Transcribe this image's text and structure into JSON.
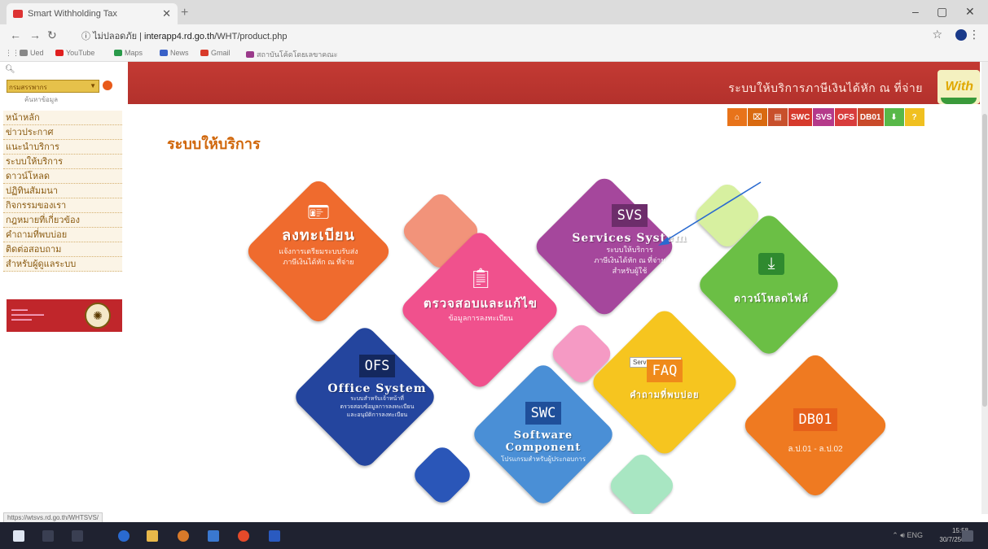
{
  "browser": {
    "tab_title": "Smart Withholding Tax",
    "new_tab": "+",
    "url_security": "ไม่ปลอดภัย",
    "url_host": "interapp4.rd.go.th",
    "url_path": "/WHT/product.php",
    "bookmarks": [
      {
        "label": "Ued",
        "color": "#888888"
      },
      {
        "label": "YouTube",
        "color": "#e02020"
      },
      {
        "label": "Maps",
        "color": "#2a9a4a"
      },
      {
        "label": "News",
        "color": "#3a62c8"
      },
      {
        "label": "Gmail",
        "color": "#d83a2a"
      },
      {
        "label": "สถาบันโค้ดโดยเลขาคณะ",
        "color": "#9a3a8a"
      }
    ]
  },
  "sidebar": {
    "select_value": "กรมสรรพากร",
    "search_sub": "ค้นหาข้อมูล",
    "menu": [
      "หน้าหลัก",
      "ข่าวประกาศ",
      "แนะนำบริการ",
      "ระบบให้บริการ",
      "ดาวน์โหลด",
      "ปฏิทินสัมมนา",
      "กิจกรรมของเรา",
      "กฎหมายที่เกี่ยวข้อง",
      "คำถามที่พบบ่อย",
      "ติดต่อสอบถาม",
      "สำหรับผู้ดูแลระบบ"
    ]
  },
  "header": {
    "title": "ระบบให้บริการภาษีเงินได้หัก ณ ที่จ่าย",
    "logo_text": "With"
  },
  "icon_row": [
    {
      "label": "⌂",
      "color": "#e8731a"
    },
    {
      "label": "⌧",
      "color": "#d96a10"
    },
    {
      "label": "▤",
      "color": "#c8502c"
    },
    {
      "label": "SWC",
      "color": "#d63a2c"
    },
    {
      "label": "SVS",
      "color": "#b53a8a"
    },
    {
      "label": "OFS",
      "color": "#d83c3c"
    },
    {
      "label": "DB01",
      "color": "#c94a2a"
    },
    {
      "label": "⬇",
      "color": "#58b848"
    },
    {
      "label": "?",
      "color": "#f0c020"
    }
  ],
  "section_title": "ระบบให้บริการ",
  "tiles": {
    "register": {
      "title": "ลงทะเบียน",
      "sub1": "แจ้งการเตรียมระบบรับส่ง",
      "sub2": "ภาษีเงินได้หัก ณ ที่จ่าย",
      "color": "#ef6b2e"
    },
    "verify": {
      "title": "ตรวจสอบและแก้ไข",
      "sub1": "ข้อมูลการลงทะเบียน",
      "color": "#f0518d"
    },
    "svs": {
      "badge": "SVS",
      "title": "Services System",
      "sub1": "ระบบให้บริการ",
      "sub2": "ภาษีเงินได้หัก ณ ที่จ่าย",
      "sub3": "สำหรับผู้ใช้",
      "color": "#a5479c"
    },
    "download": {
      "title": "ดาวน์โหลดไฟล์",
      "color": "#6bbf45"
    },
    "ofs": {
      "badge": "OFS",
      "title": "Office System",
      "sub1": "ระบบสำหรับเจ้าหน้าที่",
      "sub2": "ตรวจสอบข้อมูลการลงทะเบียน",
      "sub3": "และอนุมัติการลงทะเบียน",
      "color": "#24459e"
    },
    "swc": {
      "badge": "SWC",
      "title": "Software Component",
      "sub1": "โปรแกรมสำหรับผู้ประกอบการ",
      "color": "#4a8fd6"
    },
    "faq": {
      "badge": "FAQ",
      "title": "คำถามที่พบบ่อย",
      "color": "#f6c51f"
    },
    "db01": {
      "badge": "DB01",
      "title": "ล.ป.01 - ล.ป.02",
      "color": "#ef7a21"
    }
  },
  "decor_colors": [
    "#f2937a",
    "#d7f0a0",
    "#f59ac4",
    "#2a56b8",
    "#a8e6c2"
  ],
  "tooltip": "Service System",
  "status_url": "https://wtsvs.rd.go.th/WHTSVS/",
  "taskbar": {
    "tray": "ENG",
    "time": "15:58",
    "date": "30/7/2563"
  }
}
